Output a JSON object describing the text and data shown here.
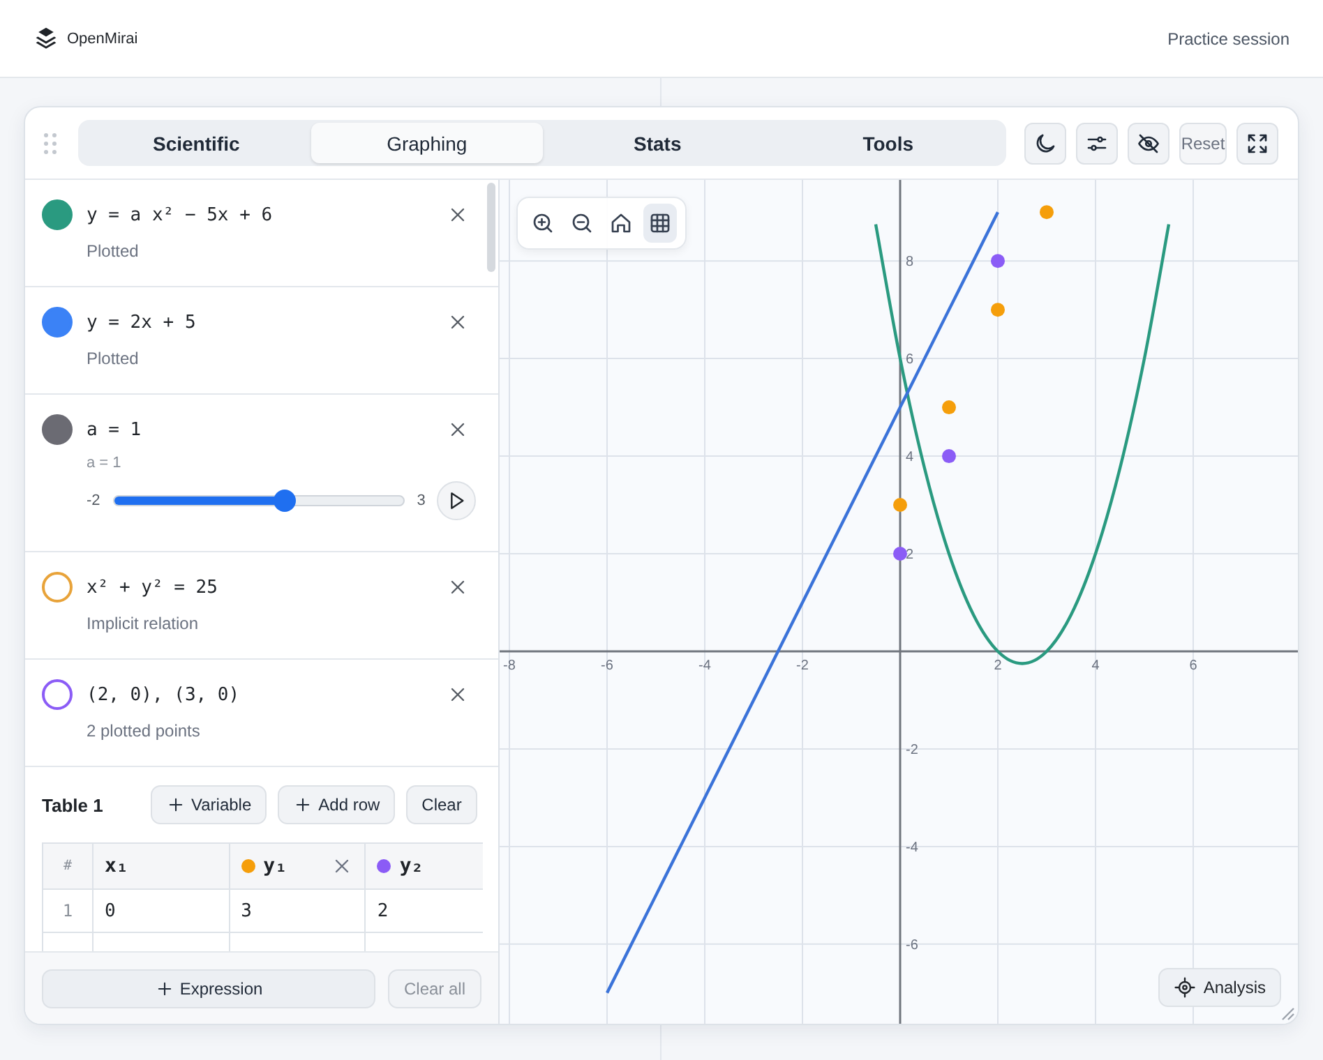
{
  "header": {
    "brand": "OpenMirai",
    "session": "Practice session"
  },
  "tabs": [
    {
      "label": "Scientific",
      "selected": false
    },
    {
      "label": "Graphing",
      "selected": true
    },
    {
      "label": "Stats",
      "selected": false
    },
    {
      "label": "Tools",
      "selected": false
    }
  ],
  "toolbar": {
    "reset": {
      "label": "Reset",
      "disabled": true
    }
  },
  "expressions": [
    {
      "kind": "expression",
      "formula": "y = a x² − 5x + 6",
      "note": "Plotted",
      "color": "#2a9a80",
      "filled": true
    },
    {
      "kind": "expression",
      "formula": "y = 2x + 5",
      "note": "Plotted",
      "color": "#3b82f6",
      "filled": true
    },
    {
      "kind": "slider",
      "formula": "a = 1",
      "note": "a = 1",
      "color": "#6b6b73",
      "filled": true,
      "min": "-2",
      "max": "3",
      "level": 0.59
    },
    {
      "kind": "expression",
      "formula": "x² + y² = 25",
      "note": "Implicit relation",
      "color": "#e8a33a",
      "filled": false
    },
    {
      "kind": "expression",
      "formula": "(2, 0), (3, 0)",
      "note": "2 plotted points",
      "color": "#8b5cf6",
      "filled": false
    }
  ],
  "table": {
    "title": "Table 1",
    "buttons": [
      {
        "kind": "add",
        "label": "Variable"
      },
      {
        "kind": "add",
        "label": "Add row"
      },
      {
        "kind": "plain",
        "label": "Clear"
      }
    ],
    "columns": [
      {
        "label": "#",
        "removable": false
      },
      {
        "label": "x₁",
        "removable": false
      },
      {
        "label": "y₁",
        "color": "#f59e0b",
        "removable": true
      },
      {
        "label": "y₂",
        "color": "#8b5cf6",
        "removable": false
      }
    ],
    "rows": [
      [
        "1",
        "0",
        "3",
        "2"
      ]
    ]
  },
  "footer": {
    "add": "Expression",
    "clear": {
      "label": "Clear all",
      "disabled": true
    }
  },
  "graph": {
    "tools": [
      {
        "kind": "zoom-in",
        "selected": false
      },
      {
        "kind": "zoom-out",
        "selected": false
      },
      {
        "kind": "home",
        "selected": false
      },
      {
        "kind": "grid",
        "selected": true
      }
    ],
    "analysis": "Analysis",
    "chart_data": {
      "type": "line",
      "grid": true,
      "xlim": [
        -8.2,
        8.2
      ],
      "ylim": [
        -7.66,
        9.66
      ],
      "xticks": [
        -8,
        -6,
        -4,
        -2,
        2,
        4,
        6
      ],
      "yticks": [
        -6,
        -4,
        -2,
        2,
        4,
        6,
        8
      ],
      "x": [
        -6,
        -5.5,
        -5,
        -4.5,
        -4,
        -3.5,
        -3,
        -2.5,
        -2,
        -1.5,
        -1,
        -0.5,
        0,
        0.5,
        1,
        1.5,
        2,
        2.5,
        3,
        3.5,
        4,
        4.5,
        5,
        5.5
      ],
      "series": [
        {
          "color": "#2a9a80",
          "values": [
            null,
            null,
            null,
            null,
            null,
            null,
            null,
            null,
            null,
            null,
            null,
            8.75,
            6,
            3.75,
            2,
            0.75,
            0,
            -0.25,
            0,
            0.75,
            2,
            3.75,
            6,
            8.75
          ]
        },
        {
          "color": "#3b73d9",
          "values": [
            -7,
            -6,
            -5,
            -4,
            -3,
            -2,
            -1,
            0,
            1,
            2,
            3,
            4,
            5,
            6,
            7,
            8,
            9,
            null,
            null,
            null,
            null,
            null,
            null,
            null
          ]
        },
        {
          "type": "scatter",
          "color": "#f59e0b",
          "values": [
            null,
            null,
            null,
            null,
            null,
            null,
            null,
            null,
            null,
            null,
            null,
            null,
            3,
            null,
            5,
            null,
            7,
            null,
            9,
            null,
            null,
            null,
            null,
            null
          ]
        },
        {
          "type": "scatter",
          "color": "#8b5cf6",
          "values": [
            null,
            null,
            null,
            null,
            null,
            null,
            null,
            null,
            null,
            null,
            null,
            null,
            2,
            null,
            4,
            null,
            8,
            null,
            null,
            null,
            null,
            null,
            null,
            null
          ]
        }
      ]
    }
  }
}
